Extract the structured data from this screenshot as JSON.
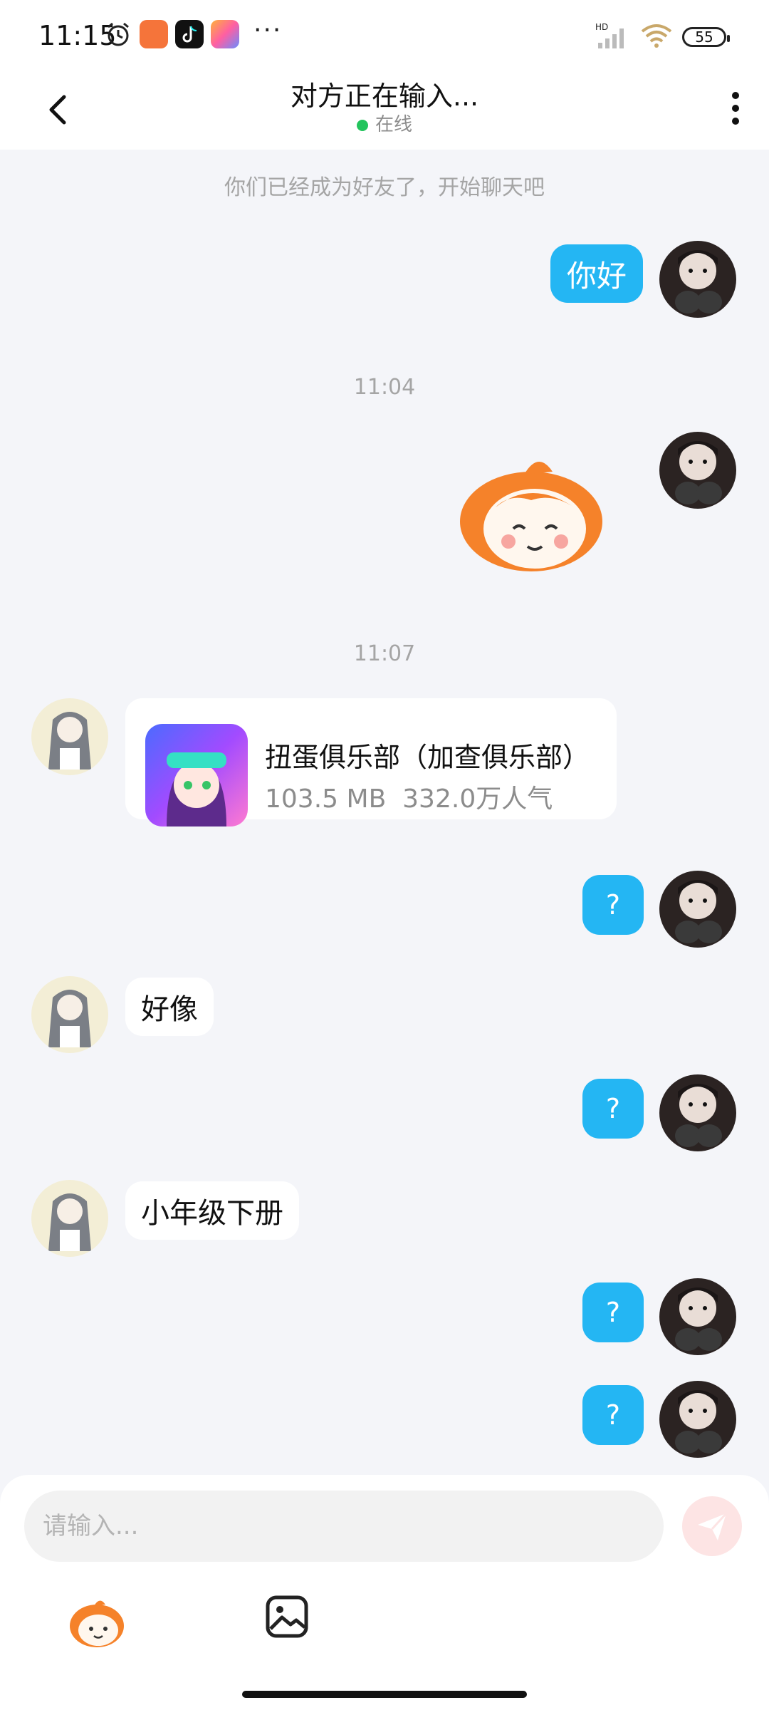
{
  "status_bar": {
    "time": "11:15",
    "more": "···",
    "battery": "55",
    "icons": [
      "alarm-icon",
      "shop-app-icon",
      "tiktok-icon",
      "game-app-icon",
      "hd-signal-icon",
      "wifi-icon"
    ]
  },
  "header": {
    "title": "对方正在输入...",
    "status": "在线",
    "status_color": "#23c45d"
  },
  "chat": {
    "system_notice": "你们已经成为好友了，开始聊天吧",
    "timestamps": [
      "11:04",
      "11:07"
    ],
    "messages": [
      {
        "sender": "me",
        "type": "text",
        "text": "你好"
      },
      {
        "sender": "me",
        "type": "sticker",
        "sticker": "orange-mascot-sticker"
      },
      {
        "sender": "other",
        "type": "app_card",
        "app_name": "扭蛋俱乐部（加查俱乐部）",
        "size": "103.5 MB",
        "popularity": "332.0万人气"
      },
      {
        "sender": "me",
        "type": "text",
        "text": "?"
      },
      {
        "sender": "other",
        "type": "text",
        "text": "好像"
      },
      {
        "sender": "me",
        "type": "text",
        "text": "?"
      },
      {
        "sender": "other",
        "type": "text",
        "text": "小年级下册"
      },
      {
        "sender": "me",
        "type": "text",
        "text": "?"
      },
      {
        "sender": "me",
        "type": "text",
        "text": "?"
      }
    ]
  },
  "input": {
    "placeholder": "请输入..."
  },
  "colors": {
    "my_bubble": "#24b6f3",
    "background": "#f4f5f9",
    "send_disabled": "#fde4e4"
  }
}
